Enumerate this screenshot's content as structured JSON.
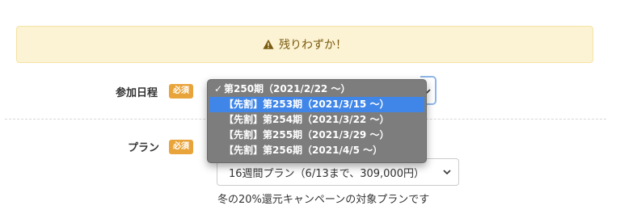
{
  "alert": {
    "text": "残りわずか！",
    "icon": "warning-triangle-icon"
  },
  "schedule": {
    "label": "参加日程",
    "badge": "必須",
    "options": [
      {
        "label": "第250期（2021/2/22 〜）",
        "selected": true
      },
      {
        "label": "【先割】第253期（2021/3/15 〜）",
        "highlighted": true
      },
      {
        "label": "【先割】第254期（2021/3/22 〜）"
      },
      {
        "label": "【先割】第255期（2021/3/29 〜）"
      },
      {
        "label": "【先割】第256期（2021/4/5 〜）"
      }
    ],
    "check_mark": "✓"
  },
  "plan": {
    "label": "プラン",
    "badge": "必須",
    "selected_value": "16週間プラン（6/13まで、309,000円）",
    "note": "冬の20%還元キャンペーンの対象プランです"
  },
  "colors": {
    "badge": "#e8a43a",
    "alert_bg": "#fcf3d4",
    "highlight": "#3f86e8",
    "dropdown_bg": "#7d7d7d"
  }
}
